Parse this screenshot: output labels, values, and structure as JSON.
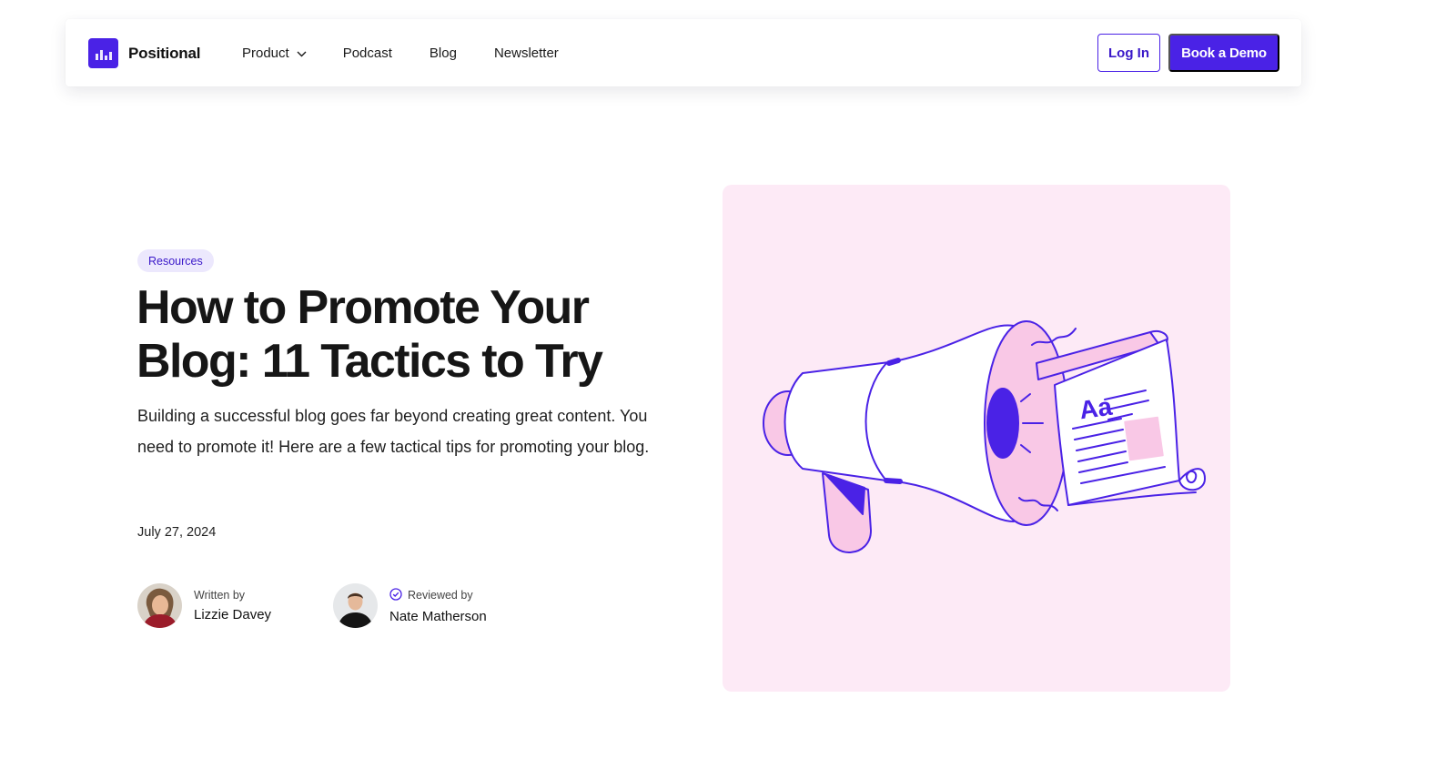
{
  "nav": {
    "brand": "Positional",
    "links": [
      "Product",
      "Podcast",
      "Blog",
      "Newsletter"
    ],
    "login_label": "Log In",
    "demo_label": "Book a Demo"
  },
  "article": {
    "category": "Resources",
    "title": "How to Promote Your Blog: 11 Tactics to Try",
    "description": "Building a successful blog goes far beyond creating great content. You need to promote it! Here are a few tactical tips for promoting your blog.",
    "date": "July 27, 2024",
    "author": {
      "role": "Written by",
      "name": "Lizzie Davey"
    },
    "reviewer": {
      "role": "Reviewed by",
      "name": "Nate Matherson"
    }
  },
  "colors": {
    "accent": "#4a22e6",
    "badge_bg": "#ece8fd",
    "illustration_bg": "#fdeaf6",
    "illustration_pink": "#f9c8e6"
  },
  "icons": [
    "logo-bars-icon",
    "chevron-down-icon",
    "verified-check-icon",
    "megaphone-illustration"
  ]
}
